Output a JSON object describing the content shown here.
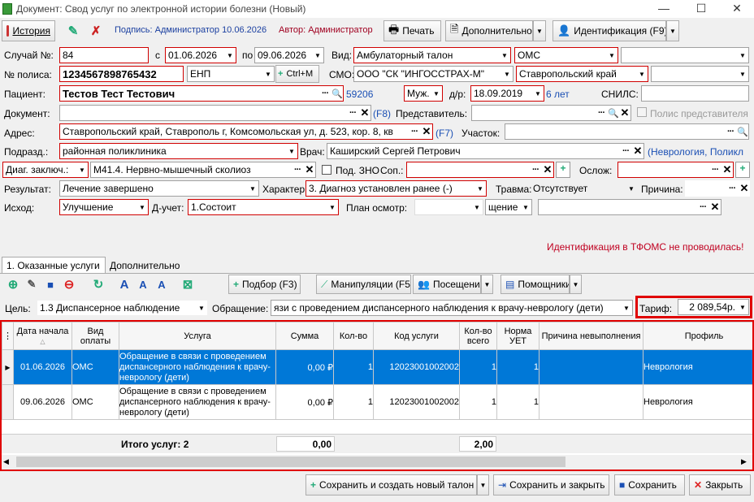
{
  "window": {
    "title": "Документ: Свод услуг по электронной истории болезни (Новый)"
  },
  "toolbar": {
    "history": "История",
    "signature": "Подпись: Администратор 10.06.2026",
    "author": "Автор: Администратор",
    "print": "Печать",
    "extra": "Дополнительно",
    "ident": "Идентификация (F9)"
  },
  "form": {
    "case_no_label": "Случай №:",
    "case_no": "84",
    "from_label": "с",
    "date_from": "01.06.2026",
    "to_label": "по",
    "date_to": "09.06.2026",
    "kind_label": "Вид:",
    "kind": "Амбулаторный талон",
    "kind2": "ОМС",
    "policy_label": "№ полиса:",
    "policy": "1234567898765432",
    "policy_type": "ЕНП",
    "ctrlm": "Ctrl+M",
    "smo_label": "СМО:",
    "smo": "ООО \"СК \"ИНГОССТРАХ-М\"",
    "region": "Ставропольский край",
    "patient_label": "Пациент:",
    "patient": "Тестов Тест Тестович",
    "patient_id": "59206",
    "sex": "Муж.",
    "dob_label": "д/р:",
    "dob": "18.09.2019",
    "age": "6 лет",
    "snils_label": "СНИЛС:",
    "doc_label": "Документ:",
    "f8": "(F8)",
    "rep_label": "Представитель:",
    "rep_policy": "Полис представителя",
    "addr_label": "Адрес:",
    "addr": "Ставропольский край, Ставрополь г, Комсомольская ул, д. 523, кор. 8, кв",
    "f7": "(F7)",
    "area_label": "Участок:",
    "dept_label": "Подразд.:",
    "dept": "районная поликлиника",
    "doctor_label": "Врач:",
    "doctor": "Каширский Сергей Петрович",
    "doctor_spec": "(Неврология, Поликл",
    "diag_label": "Диаг. заключ.:",
    "diag": "M41.4. Нервно-мышечный сколиоз",
    "zno_label": "Под. ЗНО",
    "sop_label": "Соп.:",
    "oslozh_label": "Ослож:",
    "result_label": "Результат:",
    "result": "Лечение завершено",
    "char_label": "Характер:",
    "char": "3. Диагноз установлен ранее (-)",
    "trauma_label": "Травма:",
    "trauma": "Отсутствует",
    "cause_label": "Причина:",
    "outcome_label": "Исход:",
    "outcome": "Улучшение",
    "dcheck_label": "Д-учет:",
    "dcheck": "1.Состоит",
    "plan_label": "План осмотр:",
    "plan_extra": "щение",
    "tfoms_warning": "Идентификация в ТФОМС не проводилась!"
  },
  "tabs": [
    "1. Оказанные услуги",
    "Дополнительно"
  ],
  "services_toolbar": {
    "podbor": "Подбор (F3)",
    "manip": "Манипуляции (F5)",
    "visits": "Посещения",
    "helpers": "Помощники"
  },
  "goal_label": "Цель:",
  "goal": "1.3 Диспансерное наблюдение",
  "appeal_label": "Обращение:",
  "appeal": "язи с проведением диспансерного наблюдения к врачу-неврологу (дети)",
  "tariff_label": "Тариф:",
  "tariff": "2 089,54р.",
  "table": {
    "headers": [
      "Дата начала",
      "Вид оплаты",
      "Услуга",
      "Сумма",
      "Кол-во",
      "Код услуги",
      "Кол-во всего",
      "Норма УЕТ",
      "Причина невыполнения",
      "Профиль"
    ],
    "rows": [
      {
        "date": "01.06.2026",
        "pay": "ОМС",
        "service": "Обращение в связи с проведением диспансерного наблюдения к врачу-неврологу (дети)",
        "sum": "0,00 ₽",
        "qty": "1",
        "code": "12023001002002",
        "qty_total": "1",
        "uet": "1",
        "reason": "",
        "profile": "Неврология"
      },
      {
        "date": "09.06.2026",
        "pay": "ОМС",
        "service": "Обращение в связи с проведением диспансерного наблюдения к врачу-неврологу (дети)",
        "sum": "0,00 ₽",
        "qty": "1",
        "code": "12023001002002",
        "qty_total": "1",
        "uet": "1",
        "reason": "",
        "profile": "Неврология"
      }
    ],
    "total_label": "Итого услуг: 2",
    "total_sum": "0,00",
    "total_qty": "2,00"
  },
  "footer": {
    "save_new": "Сохранить и создать новый талон",
    "save_close": "Сохранить и закрыть",
    "save": "Сохранить",
    "close": "Закрыть"
  }
}
